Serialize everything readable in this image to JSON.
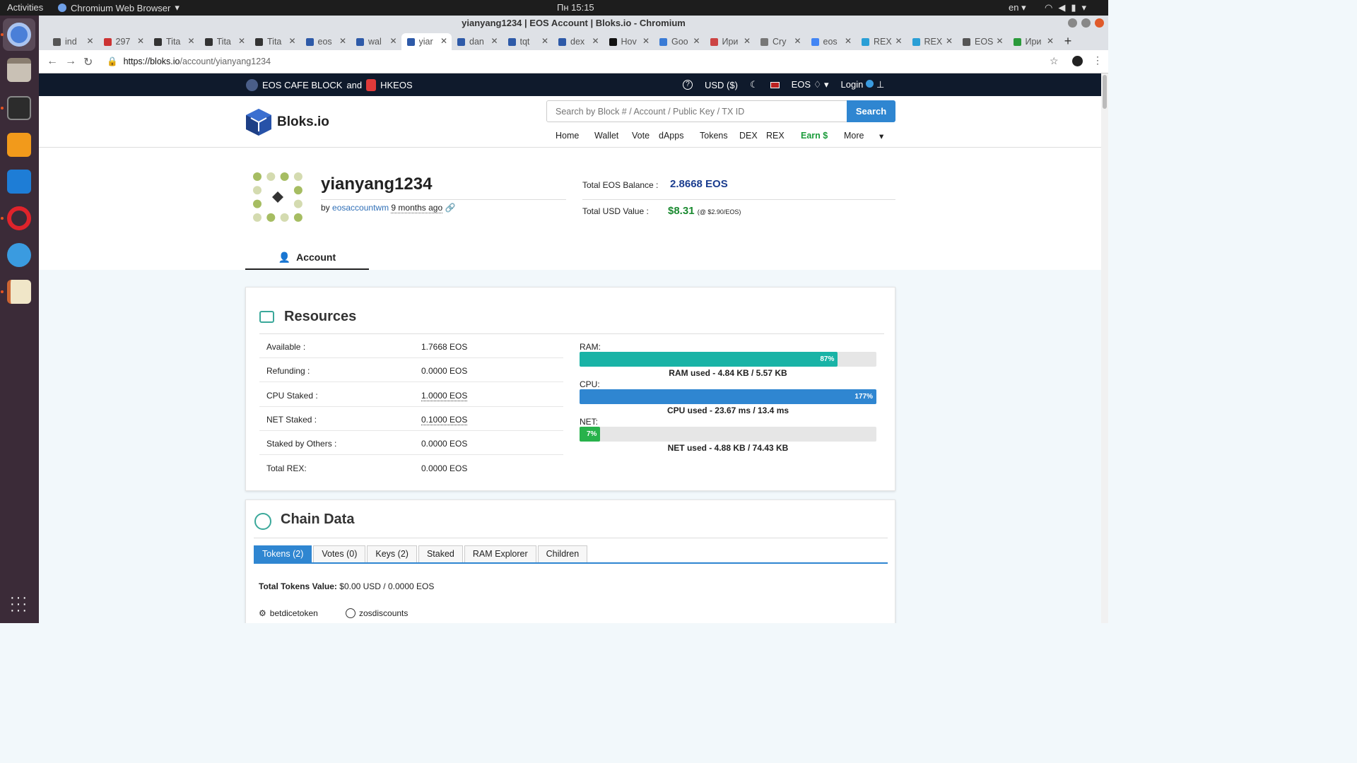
{
  "os": {
    "activities": "Activities",
    "app_menu": "Chromium Web Browser",
    "clock": "Пн 15:15",
    "lang": "en"
  },
  "browser": {
    "window_title": "yianyang1234 | EOS Account | Bloks.io - Chromium",
    "tabs": [
      "ind",
      "297",
      "Tita",
      "Tita",
      "Tita",
      "eos",
      "wal",
      "yiar",
      "dan",
      "tqt",
      "dex",
      "Hov",
      "Goo",
      "Ири",
      "Cry",
      "eos",
      "REX",
      "REX",
      "EOS",
      "Ири"
    ],
    "active_tab_index": 7,
    "url_host": "https://bloks.io",
    "url_path": "/account/yianyang1234"
  },
  "promo": {
    "left_a": "EOS CAFE BLOCK",
    "left_and": "and",
    "left_b": "HKEOS",
    "currency": "USD ($)",
    "network": "EOS",
    "login": "Login"
  },
  "header": {
    "logo": "Bloks.io",
    "search_placeholder": "Search by Block # / Account / Public Key / TX ID",
    "search_button": "Search",
    "menu": [
      "Home",
      "Wallet",
      "Vote",
      "dApps",
      "Tokens",
      "DEX",
      "REX",
      "Earn $",
      "More"
    ]
  },
  "account": {
    "name": "yianyang1234",
    "by_prefix": "by",
    "creator": "eosaccountwm",
    "created_ago": "9 months ago",
    "total_eos_label": "Total EOS Balance :",
    "total_eos_value": "2.8668 EOS",
    "total_usd_label": "Total USD Value :",
    "total_usd_value": "$8.31",
    "usd_rate": "(@ $2.90/EOS)",
    "tab": "Account"
  },
  "resources": {
    "title": "Resources",
    "rows": [
      {
        "label": "Available :",
        "value": "1.7668 EOS"
      },
      {
        "label": "Refunding :",
        "value": "0.0000 EOS"
      },
      {
        "label": "CPU Staked :",
        "value": "1.0000 EOS"
      },
      {
        "label": "NET Staked :",
        "value": "0.1000 EOS"
      },
      {
        "label": "Staked by Others :",
        "value": "0.0000 EOS"
      },
      {
        "label": "Total REX:",
        "value": "0.0000 EOS"
      }
    ],
    "ram": {
      "label": "RAM:",
      "percent_text": "87%",
      "percent": 87,
      "color": "#19b3a6",
      "caption": "RAM used - 4.84 KB / 5.57 KB"
    },
    "cpu": {
      "label": "CPU:",
      "percent_text": "177%",
      "percent": 100,
      "color": "#2f86d1",
      "caption": "CPU used - 23.67 ms / 13.4 ms"
    },
    "net": {
      "label": "NET:",
      "percent_text": "7%",
      "percent": 7,
      "color": "#28b24b",
      "caption": "NET used - 4.88 KB / 74.43 KB"
    }
  },
  "chain": {
    "title": "Chain Data",
    "tabs": [
      "Tokens (2)",
      "Votes (0)",
      "Keys (2)",
      "Staked",
      "RAM Explorer",
      "Children"
    ],
    "total_label": "Total Tokens Value:",
    "total_value": "$0.00 USD / 0.0000 EOS",
    "tokens": [
      "betdicetoken",
      "zosdiscounts"
    ]
  }
}
